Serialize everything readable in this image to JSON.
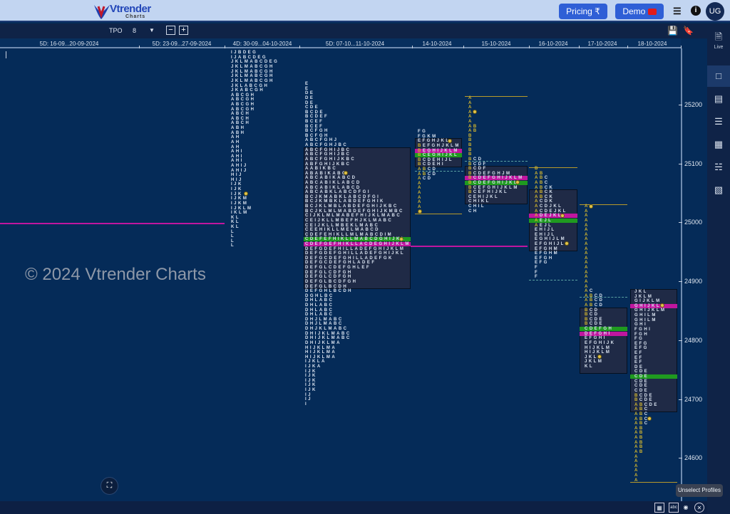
{
  "header": {
    "brand": "Vtrender",
    "brand_sub": "Charts",
    "pricing_label": "Pricing ₹",
    "demo_label": "Demo",
    "avatar": "UG",
    "icons": [
      "document-icon",
      "info-icon"
    ]
  },
  "toolbar": {
    "mode": "TPO",
    "tpo_size": "8",
    "icons": [
      "minus-icon",
      "plus-icon",
      "save-icon",
      "bookmark-icon"
    ]
  },
  "sidebar": {
    "live_label": "Live",
    "items": [
      "single-layout-icon",
      "split-layout-icon",
      "rows-layout-icon",
      "grid-layout-icon",
      "columns-layout-icon",
      "grid-6-layout-icon"
    ]
  },
  "dates": [
    "5D: 16-09...20-09-2024",
    "5D: 23-09...27-09-2024",
    "4D: 30-09...04-10-2024",
    "5D: 07-10...11-10-2024",
    "14-10-2024",
    "15-10-2024",
    "16-10-2024",
    "17-10-2024",
    "18-10-2024"
  ],
  "price_axis": [
    "25200",
    "25100",
    "25000",
    "24900",
    "24800",
    "24700",
    "24600"
  ],
  "watermark": "© 2024 Vtrender Charts",
  "tooltip": "Unselect Profiles",
  "colors": {
    "background": "#052b58",
    "poc": "#1f9a1f",
    "vpoc": "#c0169f",
    "ib_letters": "#d4b72e",
    "value_area": "#1f2a46"
  },
  "chart_data": {
    "type": "tpo",
    "tpo_size": 8,
    "profiles": [
      {
        "label": "4D: 30-09...04-10-2024",
        "high": 25288,
        "ib_color": false,
        "rows": [
          "IJBDEG",
          "IJABCDEG",
          "JKLMABCDEG",
          "JKLMABCGH",
          "JKLMABCGH",
          "JKLMABCGH",
          "JKLMABCGH",
          "JKLABCGH",
          "JKABCGH",
          "ABCGH",
          "ABCGH",
          "ABCGH",
          "ABCGH",
          "ABCH",
          "ABCH",
          "ABCH",
          "ABH",
          "ABH",
          "AH",
          "AH",
          "AH",
          "AHI",
          "AHI",
          "AHI",
          "AHIJ",
          "AHIJ",
          "HIJ",
          "HIJ",
          "IJK",
          "IJK",
          "IJK",
          "IJKM",
          "IJKM",
          "IJKLM",
          "IKLM",
          "KL",
          "KL",
          "KL",
          "L",
          "L",
          "L",
          "L"
        ],
        "dots": [
          30
        ]
      },
      {
        "label": "5D: 07-10...11-10-2024",
        "high": 25235,
        "ib_color": false,
        "va": [
          14,
          43
        ],
        "poc": 33,
        "vpoc": 34,
        "rows": [
          "E",
          "E",
          "DE",
          "DE",
          "DE",
          "CDE",
          "BCDE",
          "BCDEF",
          "BCEF",
          "BCEF",
          "BCFGH",
          "BCFGH",
          "ABCFGHJ",
          "ABCFGHJBC",
          "ABCFGHIJBC",
          "ABCFGHIJBC",
          "ABCFGHIJKBC",
          "ABFGHIJKBC",
          "AABIKBC",
          "ABABIKABC",
          "ABCABIKABCD",
          "ABCABIKLABCD",
          "ABCABIKLABCD",
          "ABCABKLABCDFGI",
          "BCJKMABKLABCDFGI",
          "BCJKMBKLABDEFGHIK",
          "BCJKLMBLABDEFGHIJKBC",
          "BCJKLMLMABDEFGHIJKMBC",
          "CIJKLMLMABEFHIJKLMABC",
          "CEIJKLLMBEFHJKLMABC",
          "CEIJKLLMBEKLMABC",
          "CEEHIKLLMELMABCD",
          "CDEFEHIKLLMLMABCDIM",
          "CDEFEFHIKLLMABCDGHIJKL",
          "CDEFGEFHIKLLACDEGHIJKLM",
          "DEFGDEFHILLADEFGHIJKLM",
          "DEFGDEFGHILLADEFGHIJKL",
          "DEFGCDEFGHILLADEFGK",
          "DEFGCDEFGHLADEF",
          "DEFGLCDEFGHLEF",
          "DEFGLCDFGH",
          "DEFGLCDFGH",
          "DEFGLBCDFGH",
          "DEFGLBCDH",
          "DEFGHLBCDH",
          "DGHLBC",
          "DHLABC",
          "DHLABC",
          "DHLABC",
          "DHLABC",
          "DHJLMABC",
          "DHJLMABC",
          "DHJKLMABC",
          "DHIJKLMABC",
          "DHIJKLMABC",
          "DHIJKLMA",
          "HIJKLMA",
          "HIJKLMA",
          "HIJKLMA",
          "IJKLA",
          "IJKA",
          "IJK",
          "IJK",
          "IJK",
          "IJK",
          "IJK",
          "IJ",
          "IJ",
          "I"
        ],
        "dots": [
          19,
          33
        ]
      },
      {
        "label": "14-10-2024",
        "high": 25154,
        "ib_color": true,
        "va": [
          2,
          7
        ],
        "poc": 5,
        "vpoc": 4,
        "rows": [
          "FG",
          "FGKM",
          "EFGHJKL",
          "BEFGHJKLM",
          "BEGHIJKLM",
          "BCEGHIJKL",
          "BCDEHIJL",
          "BCDEHI",
          "ABCD",
          "ABCD",
          "ACD",
          "A",
          "A",
          "A",
          "A",
          "A",
          "A",
          "A"
        ],
        "dots": [
          2,
          17
        ]
      },
      {
        "label": "15-10-2024",
        "high": 25211,
        "ib_color": true,
        "va": [
          15,
          22
        ],
        "poc": 18,
        "vpoc": 17,
        "rows": [
          "A",
          "A",
          "A",
          "A",
          "A",
          "A",
          "AB",
          "AB",
          "B",
          "B",
          "B",
          "B",
          "B",
          "BCD",
          "BCDF",
          "BCDF",
          "BCDEFGHJM",
          "BCDEFGHIJKLM",
          "BCDEFGHIJKL",
          "BCEFGHIJKLM",
          "BCEFHIJKL",
          "CEHIJKL",
          "CHIKL",
          "CHIL",
          "CH"
        ],
        "dots": [
          3,
          18
        ]
      },
      {
        "label": "16-10-2024",
        "high": 25091,
        "ib_color": true,
        "va": [
          5,
          17
        ],
        "poc": 11,
        "vpoc": 10,
        "rows": [
          "B",
          "AB",
          "ABC",
          "ABC",
          "ABCK",
          "ABCK",
          "ABCK",
          "ACDK",
          "ACDJKL",
          "ACDEJKL",
          "ADEJKL",
          "AEJL",
          "AEJL",
          "EHIJL",
          "EHIJL",
          "EGHIJLM",
          "EFGHIJL",
          "EFGHM",
          "EFGHM",
          "EFGH",
          "EFG",
          "F",
          "F",
          "F"
        ],
        "dots": [
          10,
          16
        ]
      },
      {
        "label": "17-10-2024",
        "high": 25027,
        "ib_color": true,
        "va": [
          22,
          35
        ],
        "poc": 26,
        "vpoc": 27,
        "rows": [
          "A",
          "A",
          "A",
          "A",
          "A",
          "A",
          "A",
          "A",
          "A",
          "A",
          "A",
          "A",
          "A",
          "A",
          "A",
          "A",
          "A",
          "A",
          "AC",
          "ABCD",
          "ABCD",
          "ABCD",
          "BCD",
          "BCD",
          "BCDE",
          "BCDE",
          "CDEFGH",
          "DEFGHI",
          "EFGHI",
          "EFGHIJK",
          "HIJKLM",
          "HIJKLM",
          "JKL",
          "JKLM",
          "KL"
        ],
        "dots": [
          0,
          32
        ]
      },
      {
        "label": "18-10-2024",
        "high": 24882,
        "ib_color": true,
        "va": [
          0,
          25
        ],
        "poc": 18,
        "vpoc": 3,
        "rows": [
          "JKL",
          "JKLM",
          "GIJKLM",
          "GHIJKL",
          "GHIJKLM",
          "GHILM",
          "GHILM",
          "GHI",
          "FGHI",
          "FGH",
          "FG",
          "EFG",
          "EFG",
          "EF",
          "EF",
          "EF",
          "DE",
          "CDE",
          "CDE",
          "CDE",
          "CDE",
          "CDE",
          "BCDE",
          "BCDE",
          "ABCDE",
          "ABC",
          "ABC",
          "ABC",
          "ABC",
          "AB",
          "AB",
          "AB",
          "AB",
          "AB",
          "AB",
          "A",
          "A",
          "A",
          "A",
          "A",
          "A"
        ],
        "dots": [
          3,
          27
        ]
      }
    ]
  }
}
